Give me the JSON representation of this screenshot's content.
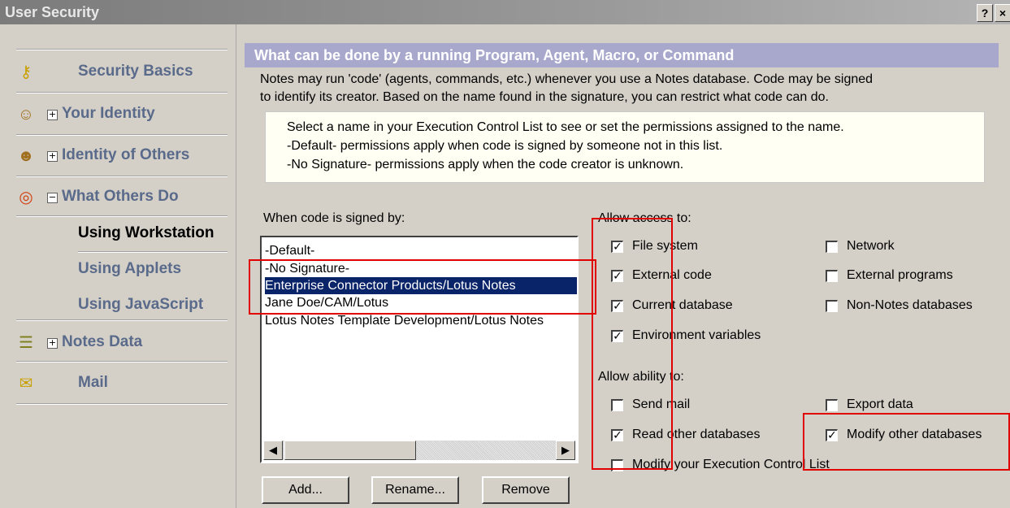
{
  "window": {
    "title": "User Security",
    "help_btn": "?",
    "close_btn": "×"
  },
  "sidebar": {
    "security_basics": "Security Basics",
    "your_identity": "Your Identity",
    "identity_of_others": "Identity of Others",
    "what_others_do": "What Others Do",
    "using_workstation": "Using Workstation",
    "using_applets": "Using Applets",
    "using_javascript": "Using JavaScript",
    "notes_data": "Notes Data",
    "mail": "Mail",
    "expand_symbol": "+",
    "collapse_symbol": "−"
  },
  "header": {
    "title": "What can be done by a running Program, Agent, Macro, or Command"
  },
  "description": {
    "line1": "Notes may run 'code' (agents, commands, etc.) whenever you use a Notes database. Code may be signed",
    "line2": "to identify its creator. Based on the name found in the signature, you can restrict what code can do."
  },
  "info": {
    "line1": "Select a name in your Execution Control List to see or set the permissions assigned to the name.",
    "line2": "-Default- permissions apply when code is signed by someone not in this list.",
    "line3": "-No Signature- permissions apply when the code creator is unknown."
  },
  "signers": {
    "label": "When code is signed by:",
    "items": [
      "-Default-",
      "-No Signature-",
      "Enterprise Connector Products/Lotus Notes",
      "Jane Doe/CAM/Lotus",
      "Lotus Notes Template Development/Lotus Notes"
    ],
    "selected_index": 2
  },
  "buttons": {
    "add": "Add...",
    "rename": "Rename...",
    "remove": "Remove"
  },
  "access": {
    "label": "Allow access to:",
    "file_system": {
      "label": "File system",
      "checked": true
    },
    "external_code": {
      "label": "External code",
      "checked": true
    },
    "current_database": {
      "label": "Current database",
      "checked": true
    },
    "environment_variables": {
      "label": "Environment variables",
      "checked": true
    },
    "network": {
      "label": "Network",
      "checked": false
    },
    "external_programs": {
      "label": "External programs",
      "checked": false
    },
    "non_notes_databases": {
      "label": "Non-Notes databases",
      "checked": false
    }
  },
  "ability": {
    "label": "Allow ability to:",
    "send_mail": {
      "label": "Send mail",
      "checked": false
    },
    "read_other_databases": {
      "label": "Read other databases",
      "checked": true
    },
    "modify_ecl": {
      "label": "Modify your Execution Control List",
      "checked": false
    },
    "export_data": {
      "label": "Export data",
      "checked": false
    },
    "modify_other_databases": {
      "label": "Modify other databases",
      "checked": true
    }
  },
  "check_mark": "✓",
  "scroll": {
    "left_arrow": "◀",
    "right_arrow": "▶"
  },
  "colors": {
    "highlight": "#0a246a",
    "annotation": "#e00000",
    "header_bg": "#a8a8cc"
  }
}
